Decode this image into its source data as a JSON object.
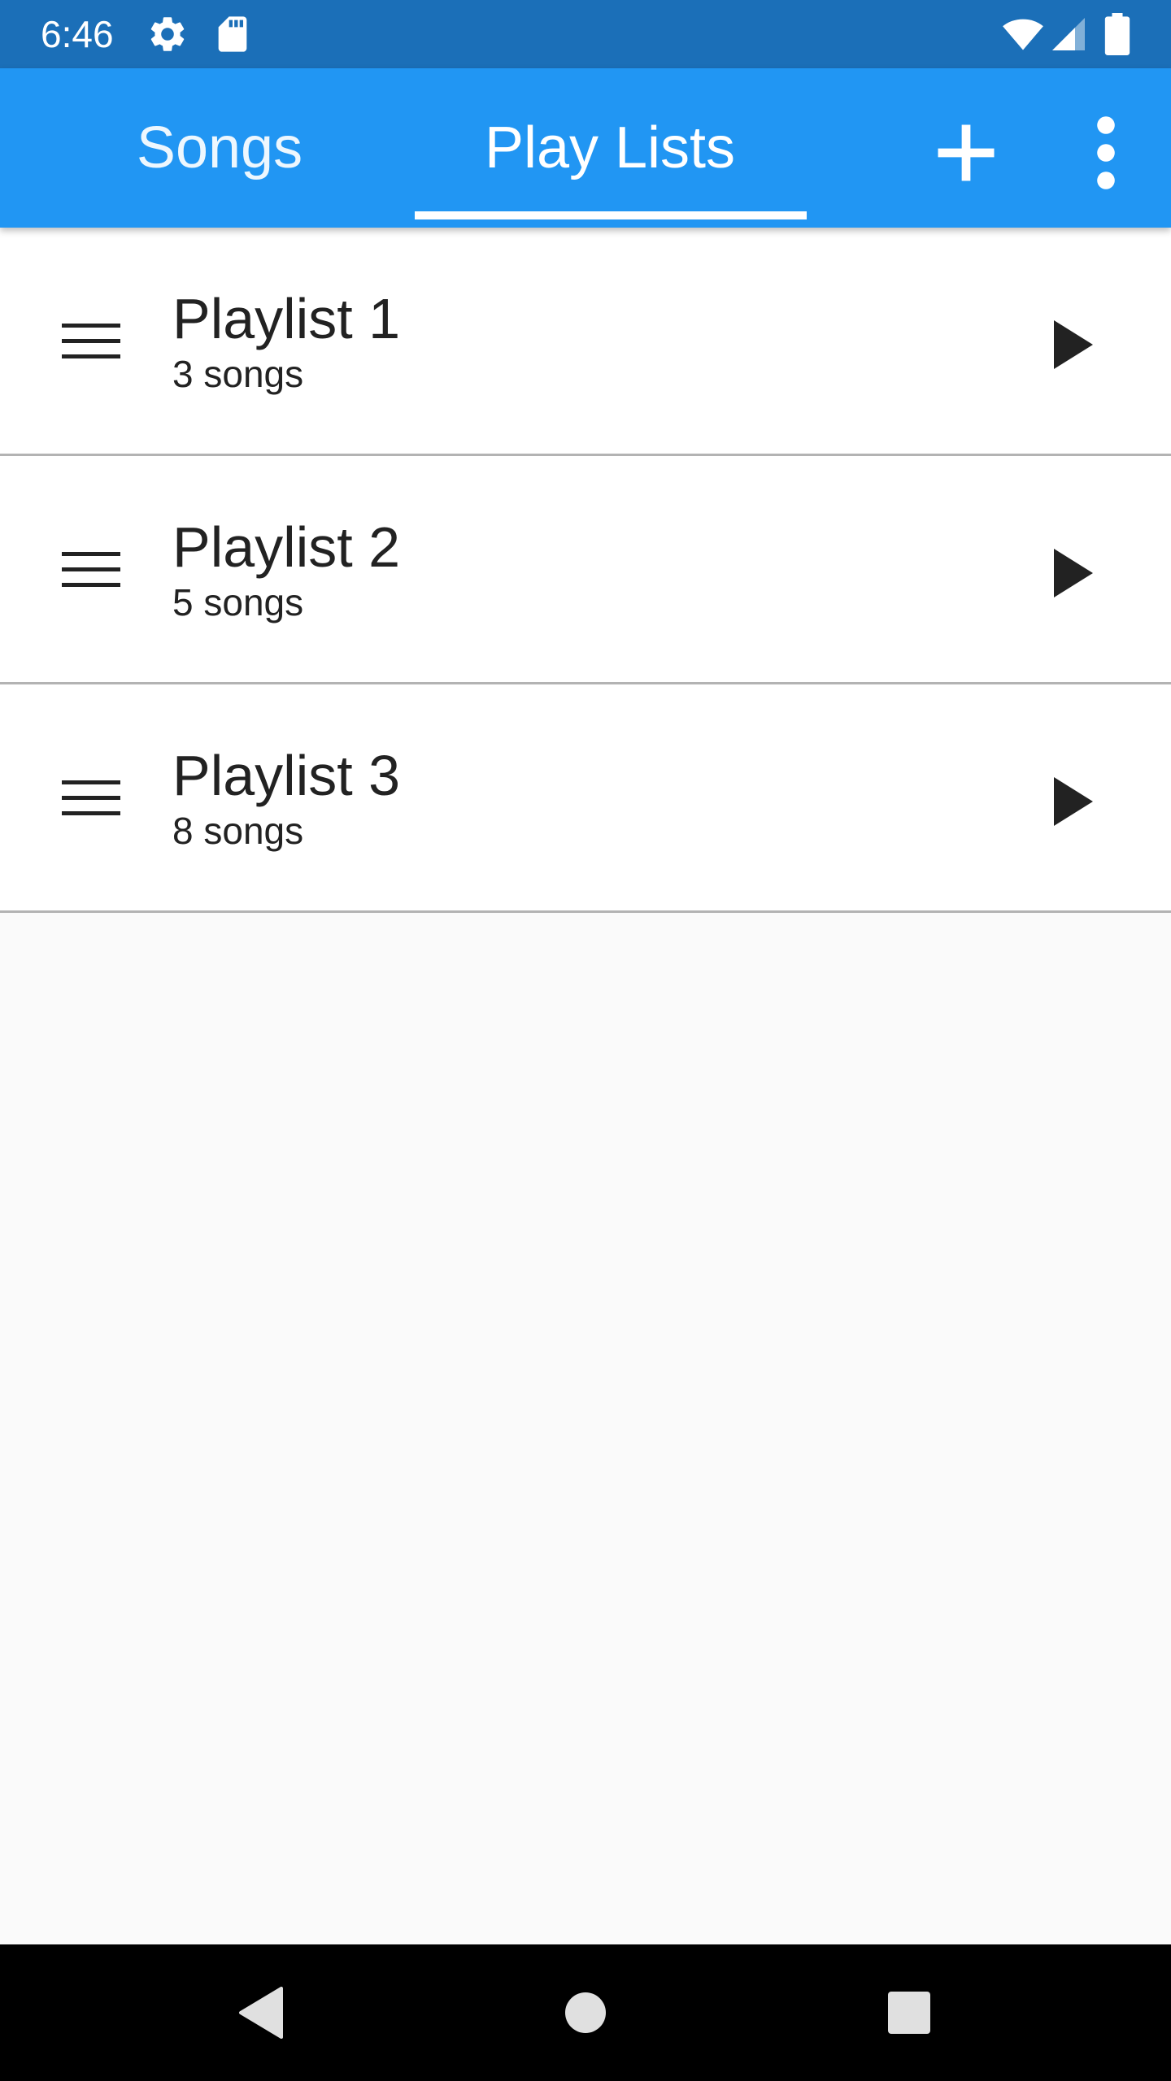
{
  "status_bar": {
    "time": "6:46",
    "icons": [
      "gear-icon",
      "sd-card-icon",
      "wifi-icon",
      "signal-icon",
      "battery-icon"
    ]
  },
  "app_bar": {
    "tabs": [
      {
        "label": "Songs",
        "selected": false
      },
      {
        "label": "Play Lists",
        "selected": true
      }
    ],
    "actions": [
      "add-icon",
      "more-vert-icon"
    ]
  },
  "playlists": [
    {
      "title": "Playlist 1",
      "subtitle": "3 songs"
    },
    {
      "title": "Playlist 2",
      "subtitle": "5 songs"
    },
    {
      "title": "Playlist 3",
      "subtitle": "8 songs"
    }
  ],
  "nav_bar": {
    "buttons": [
      "back-icon",
      "home-icon",
      "recents-icon"
    ]
  },
  "colors": {
    "status_bar": "#1b6fb8",
    "app_bar": "#2196f3",
    "background": "#fafafa",
    "row_background": "#ffffff",
    "divider": "#b3b3b3",
    "text": "#222222",
    "nav_bar": "#000000"
  }
}
